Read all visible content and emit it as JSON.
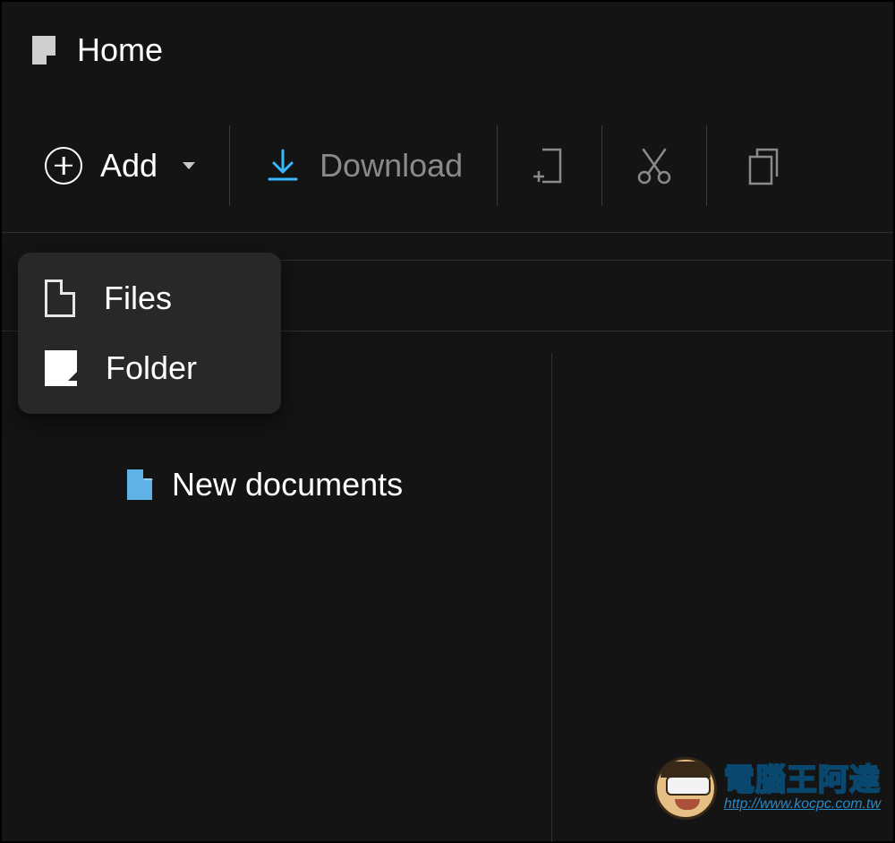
{
  "tab": {
    "title": "Home"
  },
  "toolbar": {
    "add_label": "Add",
    "download_label": "Download"
  },
  "add_menu": {
    "files": "Files",
    "folder": "Folder"
  },
  "content": {
    "item_label": "New documents"
  },
  "watermark": {
    "title": "電腦王阿達",
    "url": "http://www.kocpc.com.tw"
  }
}
